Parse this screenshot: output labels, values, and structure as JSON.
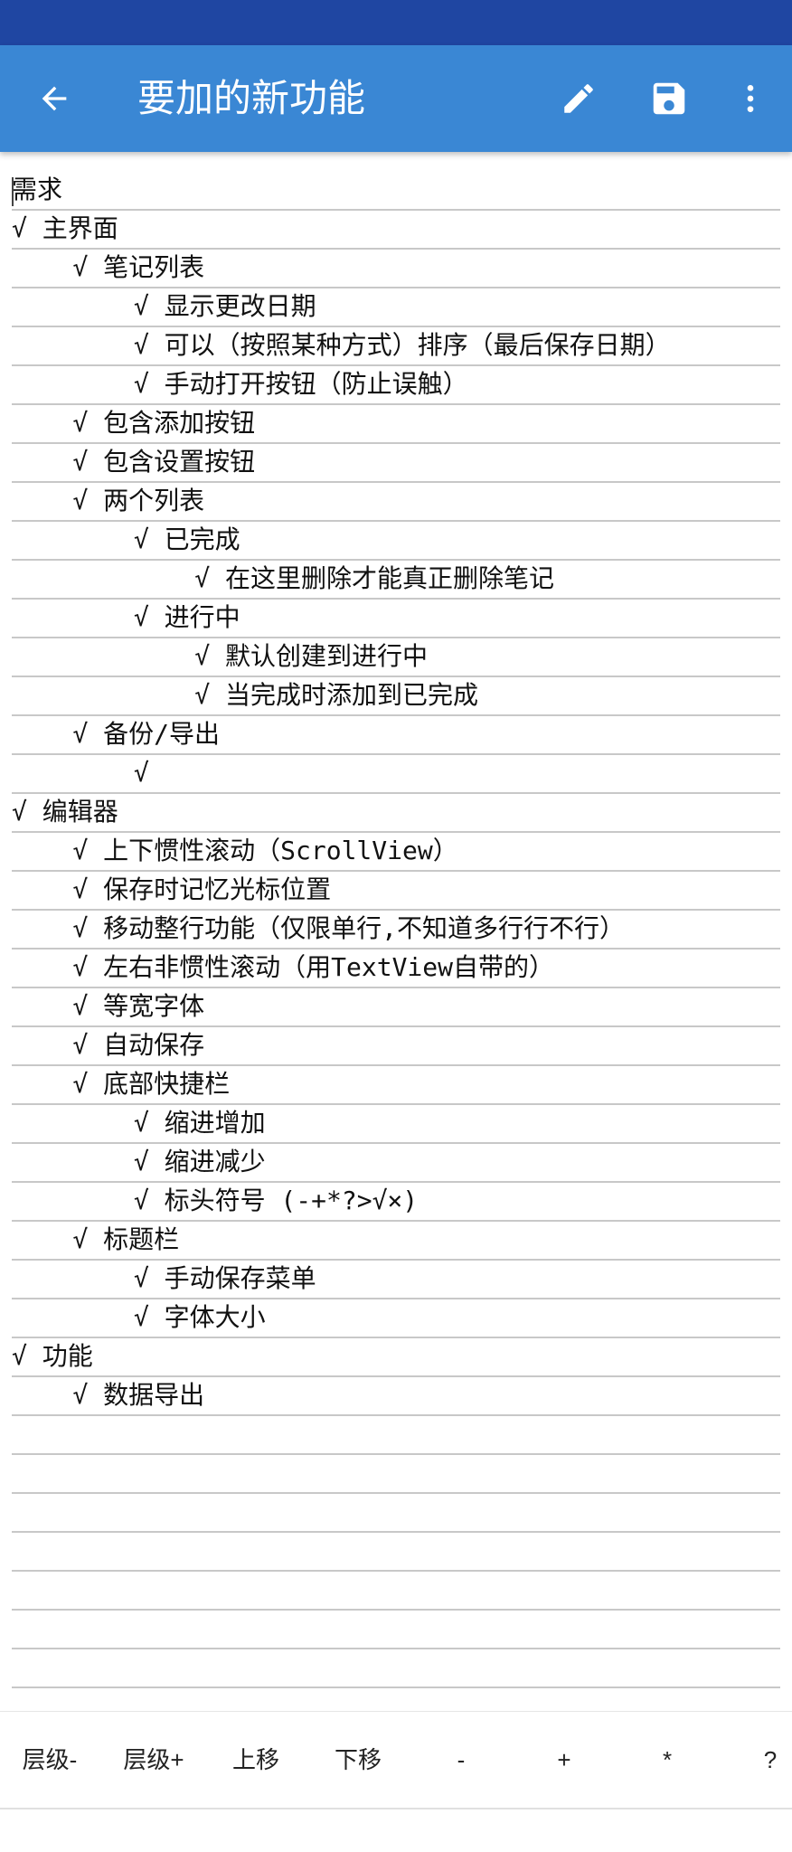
{
  "appbar": {
    "title": "要加的新功能",
    "icons": [
      "arrow-back-icon",
      "pencil-icon",
      "floppy-save-icon",
      "more-vert-icon"
    ],
    "color": "#3a87d4",
    "status_color": "#1f46a2"
  },
  "editor": {
    "lines": [
      "需求",
      "√ 主界面",
      "    √ 笔记列表",
      "        √ 显示更改日期",
      "        √ 可以（按照某种方式）排序（最后保存日期）",
      "        √ 手动打开按钮（防止误触）",
      "    √ 包含添加按钮",
      "    √ 包含设置按钮",
      "    √ 两个列表",
      "        √ 已完成",
      "            √ 在这里删除才能真正删除笔记",
      "        √ 进行中",
      "            √ 默认创建到进行中",
      "            √ 当完成时添加到已完成",
      "    √ 备份/导出",
      "        √",
      "√ 编辑器",
      "    √ 上下惯性滚动（ScrollView）",
      "    √ 保存时记忆光标位置",
      "    √ 移动整行功能（仅限单行,不知道多行行不行）",
      "    √ 左右非惯性滚动（用TextView自带的）",
      "    √ 等宽字体",
      "    √ 自动保存",
      "    √ 底部快捷栏",
      "        √ 缩进增加",
      "        √ 缩进减少",
      "        √ 标头符号 (-+*?>√×)",
      "    √ 标题栏",
      "        √ 手动保存菜单",
      "        √ 字体大小",
      "√ 功能",
      "    √ 数据导出"
    ],
    "empty_rows": 8
  },
  "toolbar": {
    "buttons": [
      "层级-",
      "层级+",
      "上移",
      "下移",
      "-",
      "+",
      "*",
      "?"
    ]
  }
}
